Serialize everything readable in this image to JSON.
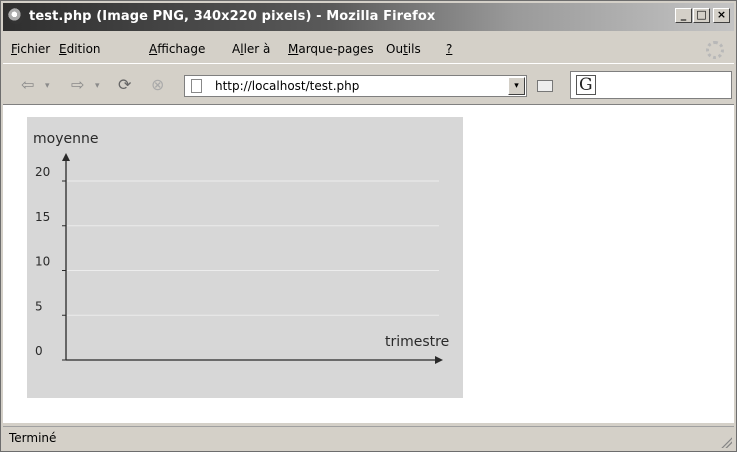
{
  "window": {
    "title": "test.php (Image PNG, 340x220 pixels) - Mozilla Firefox",
    "min": "_",
    "max": "□",
    "close": "×"
  },
  "menu": [
    {
      "pre": "",
      "u": "F",
      "post": "ichier"
    },
    {
      "pre": "",
      "u": "E",
      "post": "dition"
    },
    {
      "pre": "",
      "u": "A",
      "post": "ffichage"
    },
    {
      "pre": "A",
      "u": "l",
      "post": "ler à"
    },
    {
      "pre": "",
      "u": "M",
      "post": "arque-pages"
    },
    {
      "pre": "Ou",
      "u": "t",
      "post": "ils"
    },
    {
      "pre": "",
      "u": "?",
      "post": ""
    }
  ],
  "nav": {
    "back": "⇦",
    "forward": "⇨",
    "reload": "⟳",
    "stop": "⊗",
    "dropdown": "▾",
    "url": "http://localhost/test.php",
    "search_logo": "G"
  },
  "status": {
    "text": "Terminé"
  },
  "chart_data": {
    "type": "line",
    "title": "",
    "xlabel": "trimestre",
    "ylabel": "moyenne",
    "yticks": [
      "0",
      "5",
      "10",
      "15",
      "20"
    ],
    "ylim": [
      0,
      20
    ],
    "grid": true,
    "series": [],
    "colors": {
      "background": "#d7d7d7",
      "axis": "#2a2a2a",
      "grid": "#ececec",
      "text": "#2a2a2a"
    }
  }
}
